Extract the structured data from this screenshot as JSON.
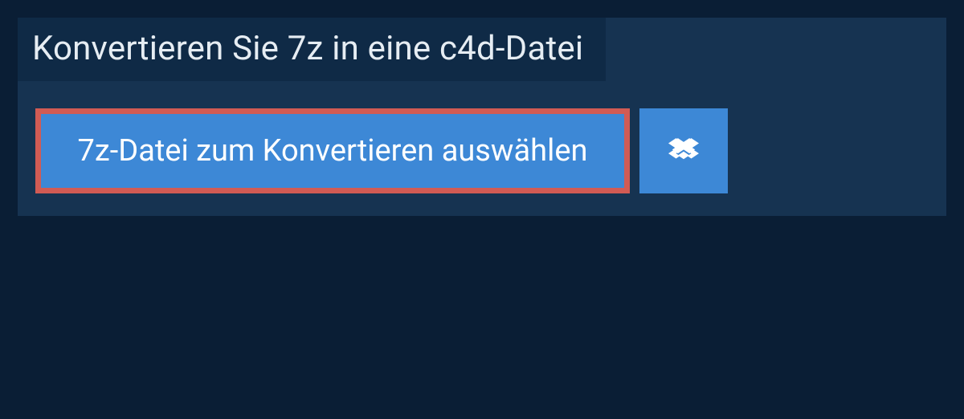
{
  "header": {
    "title": "Konvertieren Sie 7z in eine c4d-Datei"
  },
  "actions": {
    "choose_file_label": "7z-Datei zum Konvertieren auswählen",
    "dropbox_icon": "dropbox-icon"
  },
  "colors": {
    "page_bg": "#0a1e35",
    "panel_bg": "#163351",
    "titlebar_bg": "#0f2a46",
    "button_bg": "#3d88d6",
    "highlight_border": "#d15b54",
    "text_light": "#e6edf3",
    "text_white": "#ffffff"
  }
}
